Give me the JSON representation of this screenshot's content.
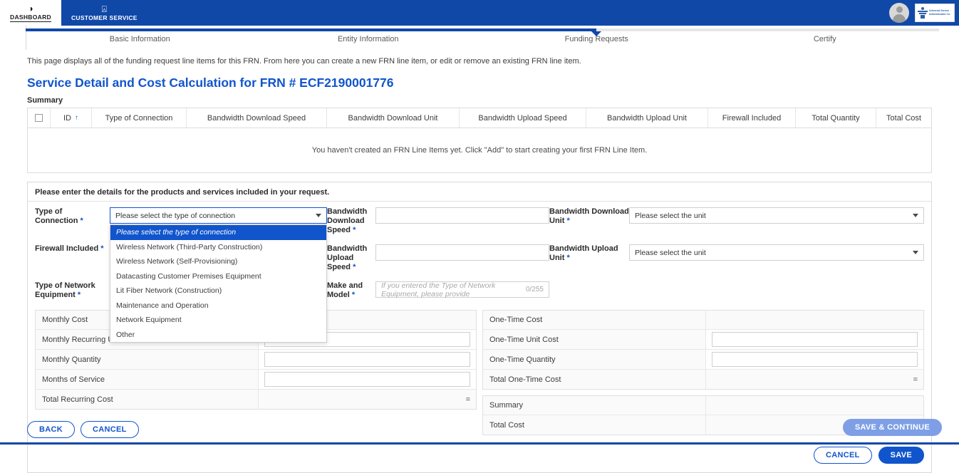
{
  "topnav": {
    "items": [
      {
        "label": "DASHBOARD",
        "icon": "dashboard-gauge-icon",
        "active": true
      },
      {
        "label": "CUSTOMER SERVICE",
        "icon": "headset-icon",
        "active": false
      }
    ],
    "logo_text": "Universal Service Administrative Co.",
    "bg_color": "#1048a8"
  },
  "stepper": {
    "steps": [
      "Basic Information",
      "Entity Information",
      "Funding Requests",
      "Certify"
    ],
    "current_index": 2,
    "fill_color": "#1048a8"
  },
  "intro_text": "This page displays all of the funding request line items for this FRN. From here you can create a new FRN line item, or edit or remove an existing FRN line item.",
  "page_title": "Service Detail and Cost Calculation for FRN # ECF2190001776",
  "summary": {
    "caption": "Summary",
    "columns": [
      "",
      "ID",
      "Type of Connection",
      "Bandwidth Download Speed",
      "Bandwidth Download Unit",
      "Bandwidth Upload Speed",
      "Bandwidth Upload Unit",
      "Firewall Included",
      "Total Quantity",
      "Total Cost"
    ],
    "sort_column": "ID",
    "sort_direction": "asc",
    "empty_message": "You haven't created an FRN Line Items yet. Click \"Add\" to start creating your first FRN Line Item."
  },
  "detail_panel": {
    "header": "Please enter the details for the products and services included in your request.",
    "fields": {
      "type_of_connection": {
        "label": "Type of Connection",
        "required": true,
        "value": "",
        "placeholder": "Please select the type of connection",
        "open": true,
        "options": [
          "Please select the type of connection",
          "Wireless Network (Third-Party Construction)",
          "Wireless Network (Self-Provisioning)",
          "Datacasting Customer Premises Equipment",
          "Lit Fiber Network (Construction)",
          "Maintenance and Operation",
          "Network Equipment",
          "Other"
        ],
        "selected_option_index": 0
      },
      "firewall_included": {
        "label": "Firewall Included",
        "required": true,
        "value": ""
      },
      "type_of_network_equipment": {
        "label": "Type of Network Equipment",
        "required": true,
        "value": ""
      },
      "bandwidth_download_speed": {
        "label": "Bandwidth Download Speed",
        "required": true,
        "value": "",
        "placeholder": ""
      },
      "bandwidth_upload_speed": {
        "label": "Bandwidth Upload Speed",
        "required": true,
        "value": "",
        "placeholder": ""
      },
      "make_and_model": {
        "label": "Make and Model",
        "required": true,
        "value": "",
        "placeholder": "If you entered the Type of Network Equipment, please provide",
        "counter": "0/255"
      },
      "bandwidth_download_unit": {
        "label": "Bandwidth Download Unit",
        "required": true,
        "value": "",
        "placeholder": "Please select the unit"
      },
      "bandwidth_upload_unit": {
        "label": "Bandwidth Upload Unit",
        "required": true,
        "value": "",
        "placeholder": "Please select the unit"
      }
    },
    "recurring_cost_rows": [
      {
        "label": "Monthly Cost",
        "value": "",
        "type": "header"
      },
      {
        "label": "Monthly Recurring Unit Cost",
        "value": "",
        "type": "input"
      },
      {
        "label": "Monthly Quantity",
        "value": "",
        "type": "input"
      },
      {
        "label": "Months of Service",
        "value": "",
        "type": "input"
      },
      {
        "label": "Total Recurring Cost",
        "value": "=",
        "type": "computed"
      }
    ],
    "onetime_cost_rows": [
      {
        "label": "One-Time Cost",
        "value": "",
        "type": "header"
      },
      {
        "label": "One-Time Unit Cost",
        "value": "",
        "type": "input"
      },
      {
        "label": "One-Time Quantity",
        "value": "",
        "type": "input"
      },
      {
        "label": "Total One-Time Cost",
        "value": "=",
        "type": "computed"
      }
    ],
    "summary_cost_rows": [
      {
        "label": "Summary",
        "value": "",
        "type": "header"
      },
      {
        "label": "Total Cost",
        "value": "=",
        "type": "computed"
      }
    ],
    "cancel_label": "CANCEL",
    "save_label": "SAVE"
  },
  "footer": {
    "back_label": "BACK",
    "cancel_label": "CANCEL",
    "save_continue_label": "SAVE & CONTINUE",
    "save_continue_disabled": true
  },
  "colors": {
    "brand_blue": "#1048a8",
    "link_blue": "#1155cc",
    "disabled_blue": "#7e9fe6"
  }
}
